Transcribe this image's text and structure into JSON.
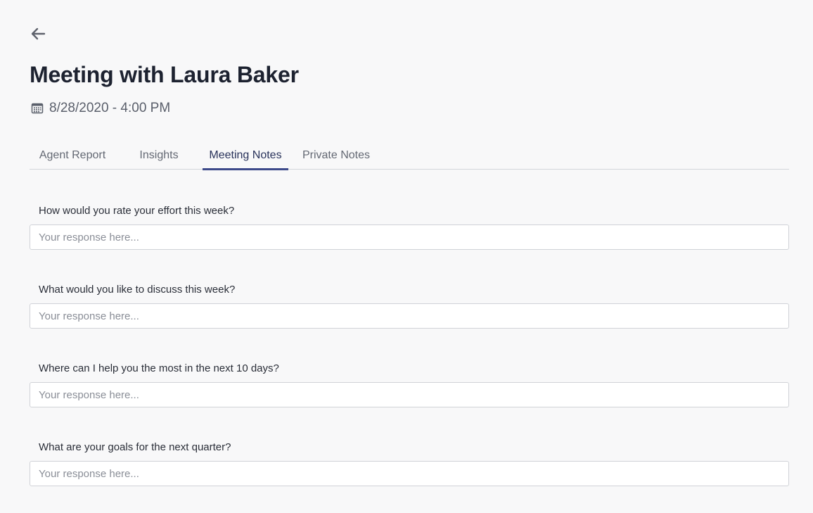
{
  "header": {
    "back_icon": "arrow-left-icon",
    "title": "Meeting with Laura Baker",
    "date_icon": "calendar-icon",
    "datetime": "8/28/2020 - 4:00 PM"
  },
  "tabs": [
    {
      "label": "Agent Report",
      "active": false
    },
    {
      "label": "Insights",
      "active": false
    },
    {
      "label": "Meeting Notes",
      "active": true
    },
    {
      "label": "Private Notes",
      "active": false
    }
  ],
  "questions": [
    {
      "label": "How would you rate your effort this week?",
      "value": "",
      "placeholder": "Your response here..."
    },
    {
      "label": "What would you like to discuss this week?",
      "value": "",
      "placeholder": "Your response here..."
    },
    {
      "label": "Where can I help you the most in the next 10 days?",
      "value": "",
      "placeholder": "Your response here..."
    },
    {
      "label": "What are your goals for the next quarter?",
      "value": "",
      "placeholder": "Your response here..."
    }
  ],
  "colors": {
    "background": "#f8f8f9",
    "active_tab_underline": "#3d4a8a",
    "title_text": "#1d2230"
  }
}
